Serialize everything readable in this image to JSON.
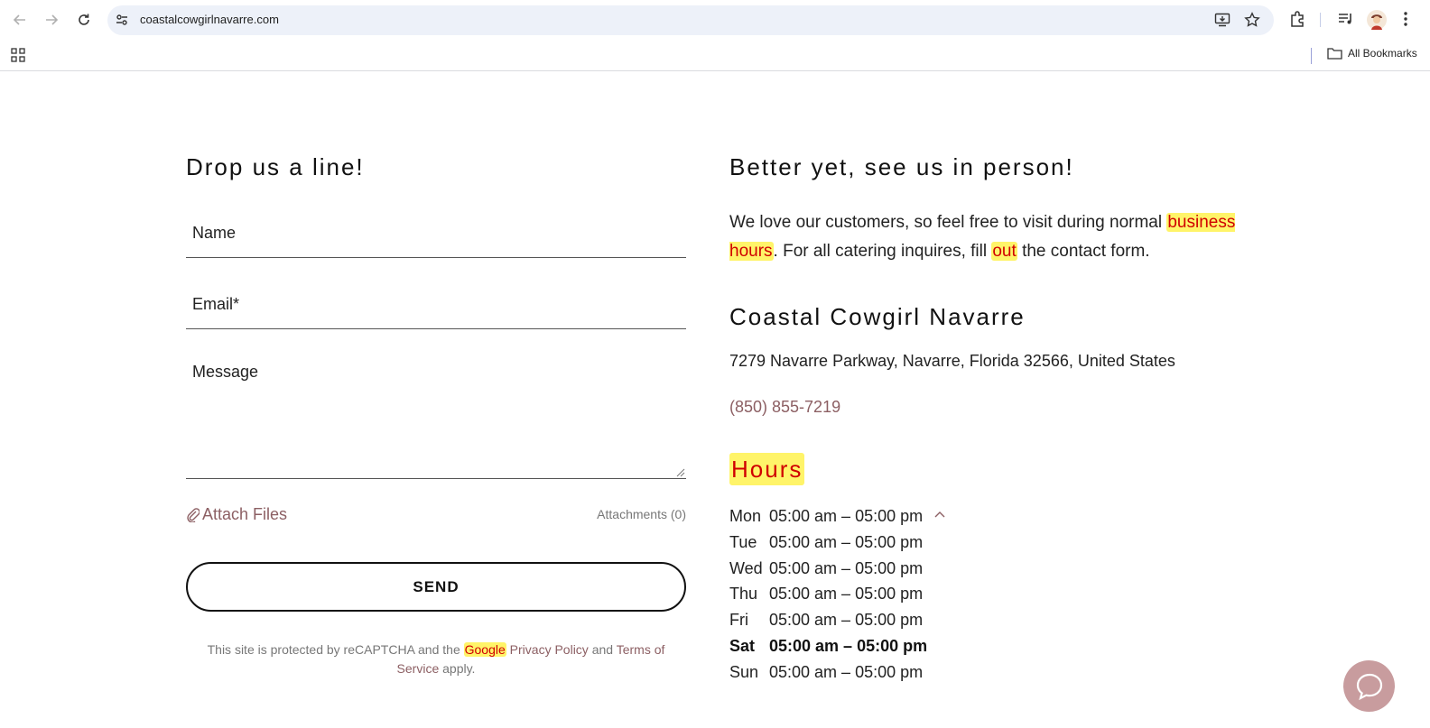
{
  "browser": {
    "url": "coastalcowgirlnavarre.com",
    "bookmarks_label": "All Bookmarks"
  },
  "contact_form": {
    "heading": "Drop us a line!",
    "name_placeholder": "Name",
    "email_placeholder": "Email*",
    "message_placeholder": "Message",
    "attach_label": "Attach Files",
    "attachments_label": "Attachments (0)",
    "send_label": "SEND",
    "recaptcha": {
      "prefix": "This site is protected by reCAPTCHA and the",
      "google": "Google",
      "privacy": "Privacy Policy",
      "and": "and",
      "terms": "Terms of Service",
      "suffix": "apply."
    }
  },
  "visit": {
    "heading": "Better yet, see us in person!",
    "intro_1": "We love our customers, so feel free to visit during normal",
    "intro_hl_1": "business hours",
    "intro_2": ". For all catering inquires, fill",
    "intro_hl_2": "out",
    "intro_3": "the contact form.",
    "business_name": "Coastal Cowgirl Navarre",
    "address": "7279 Navarre Parkway, Navarre, Florida 32566, United States",
    "phone": "(850) 855-7219",
    "hours_title": "Hours",
    "hours": [
      {
        "day": "Mon",
        "time": "05:00 am – 05:00 pm"
      },
      {
        "day": "Tue",
        "time": "05:00 am – 05:00 pm"
      },
      {
        "day": "Wed",
        "time": "05:00 am – 05:00 pm"
      },
      {
        "day": "Thu",
        "time": "05:00 am – 05:00 pm"
      },
      {
        "day": "Fri",
        "time": "05:00 am – 05:00 pm"
      },
      {
        "day": "Sat",
        "time": "05:00 am – 05:00 pm"
      },
      {
        "day": "Sun",
        "time": "05:00 am – 05:00 pm"
      }
    ]
  },
  "icons": {
    "back": "arrow-left-icon",
    "forward": "arrow-right-icon",
    "reload": "reload-icon",
    "site_info": "tune-icon",
    "install": "install-app-icon",
    "bookmark": "star-icon",
    "extensions": "puzzle-icon",
    "media": "media-control-icon",
    "avatar": "profile-avatar-icon",
    "menu": "kebab-menu-icon",
    "apps": "apps-grid-icon",
    "folder": "folder-icon",
    "paperclip": "paperclip-icon",
    "chevron": "chevron-up-icon",
    "chat": "chat-bubble-icon"
  },
  "colors": {
    "accent": "#8c5f63",
    "highlight": "#fff469",
    "highlight_text": "#d00000",
    "chat_button": "#c89c9e"
  }
}
